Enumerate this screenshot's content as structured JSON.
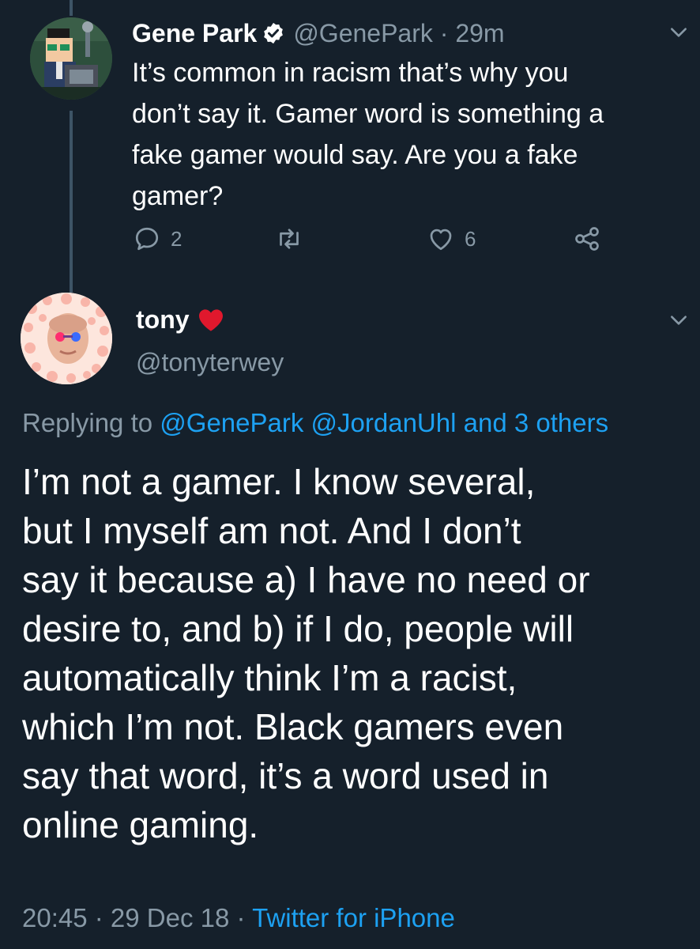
{
  "tweet1": {
    "author_name": "Gene Park",
    "handle": "@GenePark",
    "time": "29m",
    "body_lines": [
      "It’s common in racism that’s why you",
      "don’t say it. Gamer word is something a",
      "fake gamer would say. Are you a fake",
      "gamer?"
    ],
    "reply_count": "2",
    "like_count": "6",
    "icons": {
      "verified": "verified-badge-icon",
      "reply": "reply-icon",
      "retweet": "retweet-icon",
      "like": "heart-icon",
      "share": "share-icon",
      "menu": "chevron-down-icon"
    }
  },
  "tweet2": {
    "author_name": "tony",
    "name_emoji": "red-heart-emoji",
    "handle": "@tonyterwey",
    "replying_prefix": "Replying to",
    "replying_links": "@GenePark @JordanUhl and 3 others",
    "body_lines": [
      "I’m not a gamer. I know several,",
      "but I myself am not. And I don’t",
      "say it because a) I have no need or",
      "desire to, and b) if I do, people will",
      "automatically think I’m a racist,",
      "which I’m not. Black gamers even",
      "say that word, it’s a word used in",
      "online gaming."
    ],
    "timestamp": "20:45 · 29 Dec 18 · ",
    "source": "Twitter for iPhone"
  },
  "colors": {
    "background": "#15202b",
    "text_primary": "#ffffff",
    "text_secondary": "#8899a6",
    "link": "#1da1f2",
    "thread_line": "#3d5466"
  }
}
